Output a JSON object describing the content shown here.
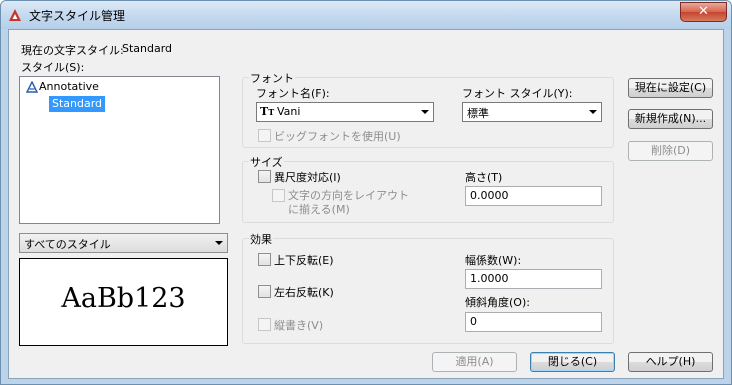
{
  "window": {
    "title": "文字スタイル管理",
    "close_glyph": "✕"
  },
  "current_style": {
    "label": "現在の文字スタイル:",
    "value": "Standard"
  },
  "styles": {
    "label": "スタイル(S):",
    "items": [
      {
        "label": "Annotative",
        "icon": "annotative-icon"
      },
      {
        "label": "Standard",
        "selected": true
      }
    ],
    "filter_value": "すべてのスタイル"
  },
  "preview": {
    "text": "AaBb123"
  },
  "font": {
    "group_title": "フォント",
    "name_label": "フォント名(F):",
    "name_value": "Vani",
    "name_icon": "truetype-icon",
    "style_label": "フォント スタイル(Y):",
    "style_value": "標準",
    "bigfont_label": "ビッグフォントを使用(U)"
  },
  "size": {
    "group_title": "サイズ",
    "annotative_label": "異尺度対応(I)",
    "orient_label_line1": "文字の方向をレイアウト",
    "orient_label_line2": "に揃える(M)",
    "height_label": "高さ(T)",
    "height_value": "0.0000"
  },
  "effects": {
    "group_title": "効果",
    "upside_down_label": "上下反転(E)",
    "backwards_label": "左右反転(K)",
    "vertical_label": "縦書き(V)",
    "width_label": "幅係数(W):",
    "width_value": "1.0000",
    "oblique_label": "傾斜角度(O):",
    "oblique_value": "0"
  },
  "buttons": {
    "set_current": "現在に設定(C)",
    "new": "新規作成(N)...",
    "delete": "削除(D)",
    "apply": "適用(A)",
    "close": "閉じる(C)",
    "help": "ヘルプ(H)"
  },
  "colors": {
    "selection": "#3399ff",
    "accent_red": "#c8342a"
  }
}
